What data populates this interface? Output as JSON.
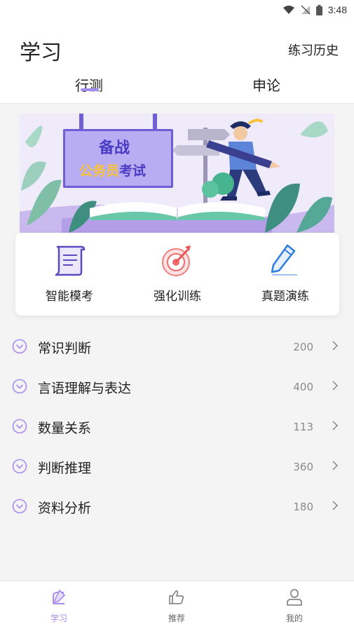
{
  "status_bar": {
    "time": "3:48"
  },
  "header": {
    "title": "学习",
    "history_label": "练习历史",
    "tabs": [
      {
        "label": "行测",
        "active": true
      },
      {
        "label": "申论",
        "active": false
      }
    ]
  },
  "banner": {
    "line1": "备战",
    "line2_accent": "公务员",
    "line2_rest": "考试"
  },
  "quick_actions": [
    {
      "label": "智能模考",
      "icon": "document-scroll-icon"
    },
    {
      "label": "强化训练",
      "icon": "target-arrow-icon"
    },
    {
      "label": "真题演练",
      "icon": "pencil-icon"
    }
  ],
  "categories": [
    {
      "name": "常识判断",
      "count": "200"
    },
    {
      "name": "言语理解与表达",
      "count": "400"
    },
    {
      "name": "数量关系",
      "count": "113"
    },
    {
      "name": "判断推理",
      "count": "360"
    },
    {
      "name": "资料分析",
      "count": "180"
    }
  ],
  "bottom_nav": [
    {
      "label": "学习",
      "icon": "study-icon",
      "active": true
    },
    {
      "label": "推荐",
      "icon": "thumbs-up-icon",
      "active": false
    },
    {
      "label": "我的",
      "icon": "profile-icon",
      "active": false
    }
  ],
  "colors": {
    "accent": "#a78bf0",
    "banner_purple": "#6f5fd6",
    "banner_yellow": "#f6c33b",
    "count_gray": "#8a8a8a"
  }
}
